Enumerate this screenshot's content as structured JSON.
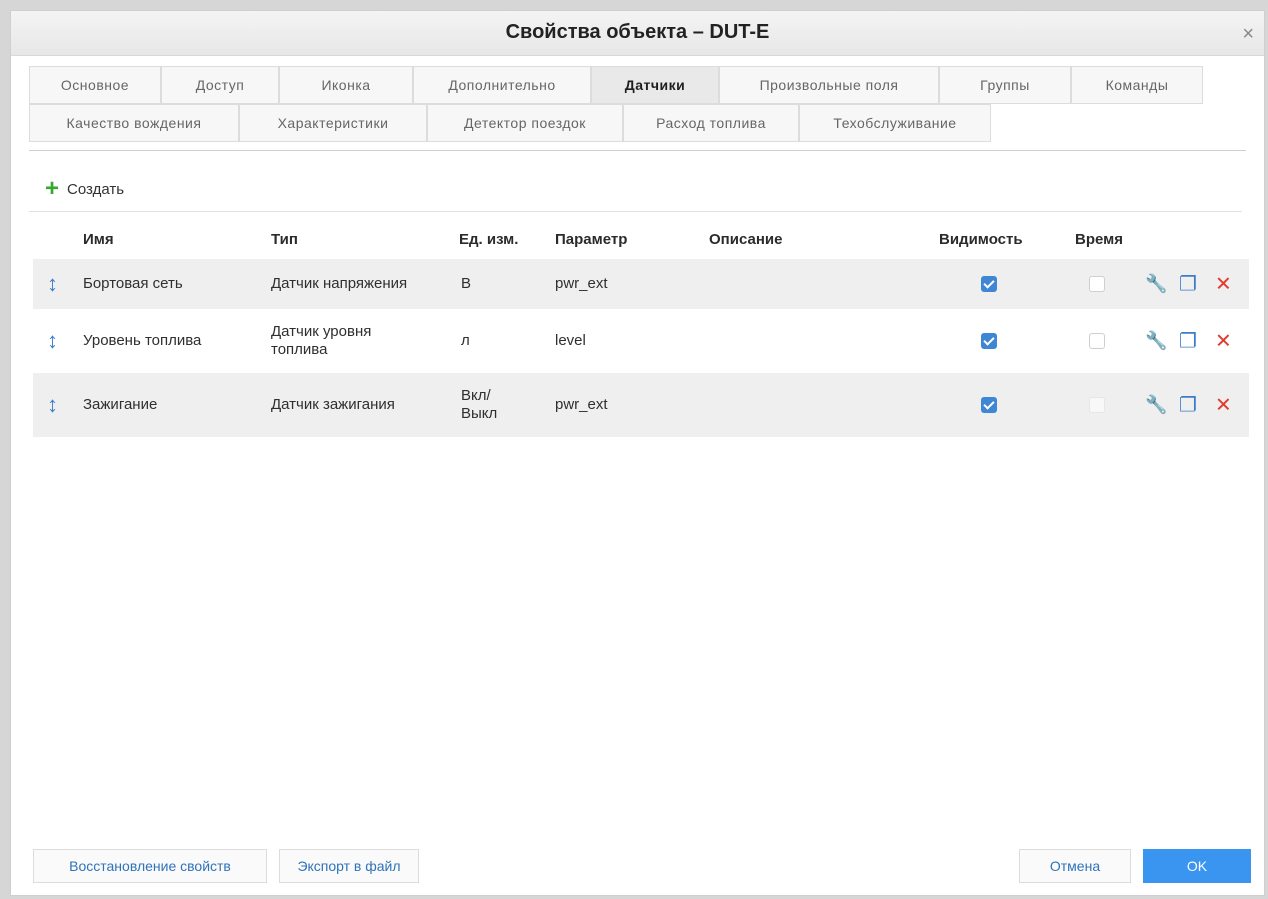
{
  "dialog": {
    "title": "Свойства объекта – DUT-E",
    "close_icon": "×"
  },
  "tabs": {
    "row1": [
      "Основное",
      "Доступ",
      "Иконка",
      "Дополнительно",
      "Датчики",
      "Произвольные поля",
      "Группы",
      "Команды"
    ],
    "row2": [
      "Качество вождения",
      "Характеристики",
      "Детектор поездок",
      "Расход топлива",
      "Техобслуживание"
    ],
    "active": "Датчики"
  },
  "toolbar": {
    "create_label": "Создать",
    "create_icon": "plus-icon"
  },
  "table": {
    "headers": {
      "name": "Имя",
      "type": "Тип",
      "unit": "Ед. изм.",
      "param": "Параметр",
      "desc": "Описание",
      "visibility": "Видимость",
      "time": "Время"
    },
    "rows": [
      {
        "name": "Бортовая сеть",
        "type": "Датчик напряжения",
        "unit": "В",
        "param": "pwr_ext",
        "desc": "",
        "visible": true,
        "time": false
      },
      {
        "name": "Уровень топлива",
        "type": "Датчик уровня топлива",
        "unit": "л",
        "param": "level",
        "desc": "",
        "visible": true,
        "time": false
      },
      {
        "name": "Зажигание",
        "type": "Датчик зажигания",
        "unit": "Вкл/ Выкл",
        "param": "pwr_ext",
        "desc": "",
        "visible": true,
        "time": false
      }
    ]
  },
  "buttons": {
    "restore": "Восстановление свойств",
    "export": "Экспорт в файл",
    "cancel": "Отмена",
    "ok": "OK"
  },
  "colors": {
    "accent": "#3a95f1",
    "create": "#35a92c",
    "delete": "#e23b2e",
    "row_shade": "#efefef"
  }
}
